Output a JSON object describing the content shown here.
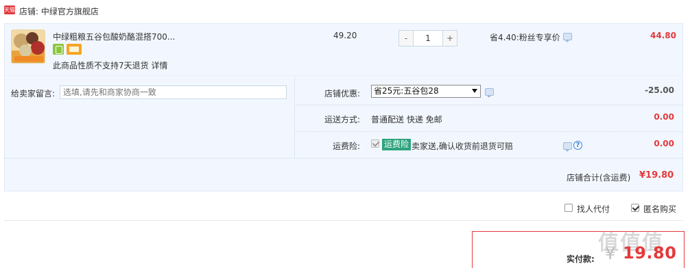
{
  "shop": {
    "badge": "天猫",
    "label": "店铺: 中绿官方旗舰店"
  },
  "item": {
    "title": "中绿粗粮五谷包酸奶酪混搭700...",
    "note": "此商品性质不支持7天退货 详情",
    "price": "49.20",
    "quantity": "1",
    "qty_minus": "-",
    "qty_plus": "+",
    "promo": "省4.40:粉丝专享价",
    "total": "44.80",
    "service_icons": [
      "phone-icon",
      "card-icon"
    ]
  },
  "message": {
    "label": "给卖家留言:",
    "placeholder": "选填,请先和商家协商一致"
  },
  "coupon": {
    "label": "店铺优惠:",
    "selected": "省25元:五谷包28",
    "amount": "-25.00"
  },
  "shipping": {
    "label": "运送方式:",
    "value": "普通配送 快递 免邮",
    "amount": "0.00"
  },
  "insurance": {
    "label": "运费险:",
    "badge": "运费险",
    "text": "卖家送,确认收货前退货可赔",
    "amount": "0.00",
    "help": "?"
  },
  "subtotal": {
    "label": "店铺合计(含运费)",
    "value": "¥19.80"
  },
  "options": {
    "proxy_pay": "找人代付",
    "anonymous": "匿名购买"
  },
  "pay": {
    "label": "实付款:",
    "currency": "¥",
    "value": "19.80"
  },
  "watermark": "值值值",
  "colors": {
    "accent": "#e4393c",
    "row_bg": "#f2f7ff",
    "insurance_badge": "#2fa37d"
  }
}
